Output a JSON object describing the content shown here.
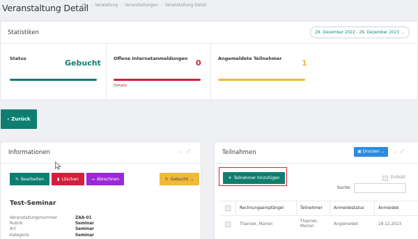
{
  "header": {
    "title": "Veranstaltung Detail",
    "breadcrumbs": [
      "Verwaltung",
      "Veranstaltungen",
      "Veranstaltung Detail"
    ]
  },
  "stats": {
    "title": "Statistiken",
    "date_range": "29. Dezember 2022 - 29. Dezember 2023",
    "items": [
      {
        "label": "Status",
        "value": "Gebucht",
        "color": "#0e7e70",
        "progress": 1.0
      },
      {
        "label": "Offene Internetanmeldungen",
        "value": "0",
        "color": "#d21f3c",
        "progress": 1.0,
        "link": "Details"
      },
      {
        "label": "Angemeldete Teilnehmer",
        "value": "1",
        "color": "#f0b93a",
        "progress": 1.0
      }
    ]
  },
  "back_label": "Zurück",
  "info": {
    "title": "Informationen",
    "buttons": {
      "edit": "Bearbeiten",
      "delete": "Löschen",
      "bill": "Abrechnen",
      "status": "Gebucht"
    },
    "name": "Test-Seminar",
    "fields": [
      {
        "key": "Veranstaltungsnummer",
        "value": "ZAA-01"
      },
      {
        "key": "Rubrik",
        "value": "Seminar"
      },
      {
        "key": "Art",
        "value": "Seminar"
      },
      {
        "key": "Kategorie",
        "value": "Seminar"
      }
    ]
  },
  "teil": {
    "title": "Teilnahmen",
    "print_label": "Drucken",
    "add_label": "Teilnehmer hinzufügen",
    "enthalt_label": "Enthält",
    "search_label": "Suche:",
    "search_value": "",
    "columns": [
      "Rechnungsempfänger",
      "Teilnehmer",
      "Anmeldestatus",
      "Anmeldeb"
    ],
    "rows": [
      {
        "empf": "Thanner, Marion",
        "teil_line1": "Thanner,",
        "teil_line2": "Marion",
        "status": "Angemeldet",
        "date": "28.12.2023"
      }
    ]
  },
  "colors": {
    "primary": "#0e7e70",
    "danger": "#d21f3c",
    "violet": "#9b29d6",
    "warning": "#f0b93a",
    "info": "#2c8be0",
    "highlight": "#e0192a"
  }
}
